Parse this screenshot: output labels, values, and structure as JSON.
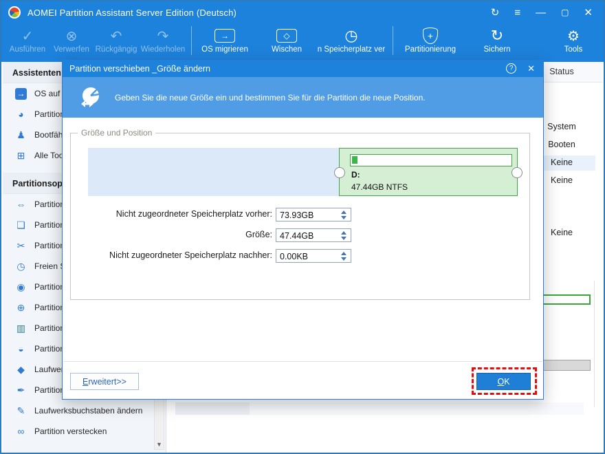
{
  "window": {
    "title": "AOMEI Partition Assistant Server Edition (Deutsch)",
    "controls": {
      "refresh": "↻",
      "menu": "≡",
      "minimize": "—",
      "maximize": "▢",
      "close": "✕"
    }
  },
  "toolbar": {
    "buttons": [
      {
        "label": "Ausführen",
        "icon": "check-icon",
        "glyph": "✓",
        "disabled": true
      },
      {
        "label": "Verwerfen",
        "icon": "discard-icon",
        "glyph": "⊗",
        "disabled": true
      },
      {
        "label": "Rückgängig",
        "icon": "undo-icon",
        "glyph": "↶",
        "disabled": true
      },
      {
        "label": "Wiederholen",
        "icon": "redo-icon",
        "glyph": "↷",
        "disabled": true
      },
      {
        "label": "OS migrieren",
        "icon": "disk-migrate-icon",
        "glyph": "→"
      },
      {
        "label": "Wischen",
        "icon": "disk-wipe-icon",
        "glyph": "◇"
      },
      {
        "label": "n Speicherplatz ver",
        "icon": "pie-clock-icon",
        "glyph": "◷"
      },
      {
        "label": "Partitionierung",
        "icon": "shield-plus-icon",
        "glyph": "+"
      },
      {
        "label": "Sichern",
        "icon": "backup-sync-icon",
        "glyph": "↻"
      },
      {
        "label": "Tools",
        "icon": "wrench-icon",
        "glyph": "⚙"
      }
    ]
  },
  "sidebar": {
    "items": [
      {
        "type": "header",
        "label": "Assistenten"
      },
      {
        "icon": "disk-arrow-icon",
        "glyph": "→",
        "label": "OS auf S"
      },
      {
        "icon": "pie-chart-icon",
        "glyph": "◕",
        "label": "Partition"
      },
      {
        "icon": "bootable-media-icon",
        "glyph": "♟",
        "label": "Bootfähi"
      },
      {
        "icon": "all-tools-icon",
        "glyph": "⊞",
        "label": "Alle Tool"
      },
      {
        "type": "header",
        "label": "Partitionsop"
      },
      {
        "icon": "move-resize-icon",
        "glyph": "⇔",
        "label": "Partition"
      },
      {
        "icon": "copy-icon",
        "glyph": "❏",
        "label": "Partition"
      },
      {
        "icon": "split-icon",
        "glyph": "✂",
        "label": "Partition"
      },
      {
        "icon": "free-space-icon",
        "glyph": "◷",
        "label": "Freien Sp"
      },
      {
        "icon": "merge-icon",
        "glyph": "◉",
        "label": "Partition"
      },
      {
        "icon": "create-partition-icon",
        "glyph": "⊕",
        "label": "Partition"
      },
      {
        "icon": "trash-icon",
        "glyph": "▥",
        "label": "Partition"
      },
      {
        "icon": "format-partition-icon",
        "glyph": "◒",
        "label": "Partition"
      },
      {
        "icon": "drive-tag-icon",
        "glyph": "◆",
        "label": "Laufwerk"
      },
      {
        "icon": "broom-icon",
        "glyph": "✒",
        "label": "Partition"
      },
      {
        "icon": "pencil-icon",
        "glyph": "✎",
        "label": "Laufwerksbuchstaben ändern"
      },
      {
        "icon": "hide-glasses-icon",
        "glyph": "∞",
        "label": "Partition verstecken"
      }
    ],
    "scroll_down_arrow": "▼"
  },
  "main_table": {
    "status_header": "Status",
    "rows": [
      "System",
      "Booten",
      "Keine",
      "Keine",
      "Keine"
    ]
  },
  "dialog": {
    "title": "Partition verschieben _Größe ändern",
    "help_glyph": "?",
    "close_glyph": "✕",
    "subtitle": "Geben Sie die neue Größe ein und bestimmen Sie für die Partition die neue Position.",
    "groupbox_label": "Größe und Position",
    "partition": {
      "name": "D:",
      "size_fs": "47.44GB NTFS"
    },
    "fields": [
      {
        "label": "Nicht zugeordneter Speicherplatz vorher:",
        "value": "73.93GB"
      },
      {
        "label": "Größe:",
        "value": "47.44GB"
      },
      {
        "label": "Nicht zugeordneter Speicherplatz nachher:",
        "value": "0.00KB"
      }
    ],
    "advanced_label": "Erweitert>>",
    "ok_label": "OK"
  },
  "colors": {
    "titlebar_blue": "#1d82dc",
    "dialog_header_blue": "#509de6",
    "partition_green_border": "#44a344",
    "partition_green_fill": "#d5efd5",
    "unallocated_blue": "#dce9f8",
    "ok_button_blue": "#1f7fd6",
    "annotation_red": "#e01010",
    "highlight_row": "#e9f2fc"
  }
}
